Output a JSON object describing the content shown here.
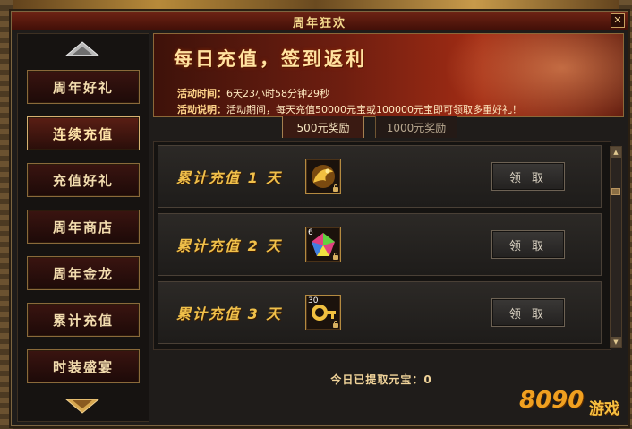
{
  "window": {
    "title": "周年狂欢",
    "close_label": "✕"
  },
  "sidebar": {
    "items": [
      {
        "label": "周年好礼",
        "active": false
      },
      {
        "label": "连续充值",
        "active": true
      },
      {
        "label": "充值好礼",
        "active": false
      },
      {
        "label": "周年商店",
        "active": false
      },
      {
        "label": "周年金龙",
        "active": false
      },
      {
        "label": "累计充值",
        "active": false
      },
      {
        "label": "时装盛宴",
        "active": false
      }
    ]
  },
  "banner": {
    "title": "每日充值，签到返利",
    "time_label": "活动时间：",
    "time_value": "6天23小时58分钟29秒",
    "desc_label": "活动说明：",
    "desc_value": "活动期间，每天充值50000元宝或100000元宝即可领取多重好礼！"
  },
  "tabs": [
    {
      "label": "500元奖励",
      "active": true
    },
    {
      "label": "1000元奖励",
      "active": false
    }
  ],
  "rewards": [
    {
      "label": "累计充值 1 天",
      "item_count": "",
      "claim_label": "领 取"
    },
    {
      "label": "累计充值 2 天",
      "item_count": "6",
      "claim_label": "领 取"
    },
    {
      "label": "累计充值 3 天",
      "item_count": "30",
      "claim_label": "领 取"
    }
  ],
  "footer": {
    "today_text": "今日已提取元宝：0"
  },
  "watermark": {
    "number": "8090",
    "word": "游戏"
  },
  "colors": {
    "accent_gold": "#f0c04a",
    "title_red": "#6e2414"
  }
}
